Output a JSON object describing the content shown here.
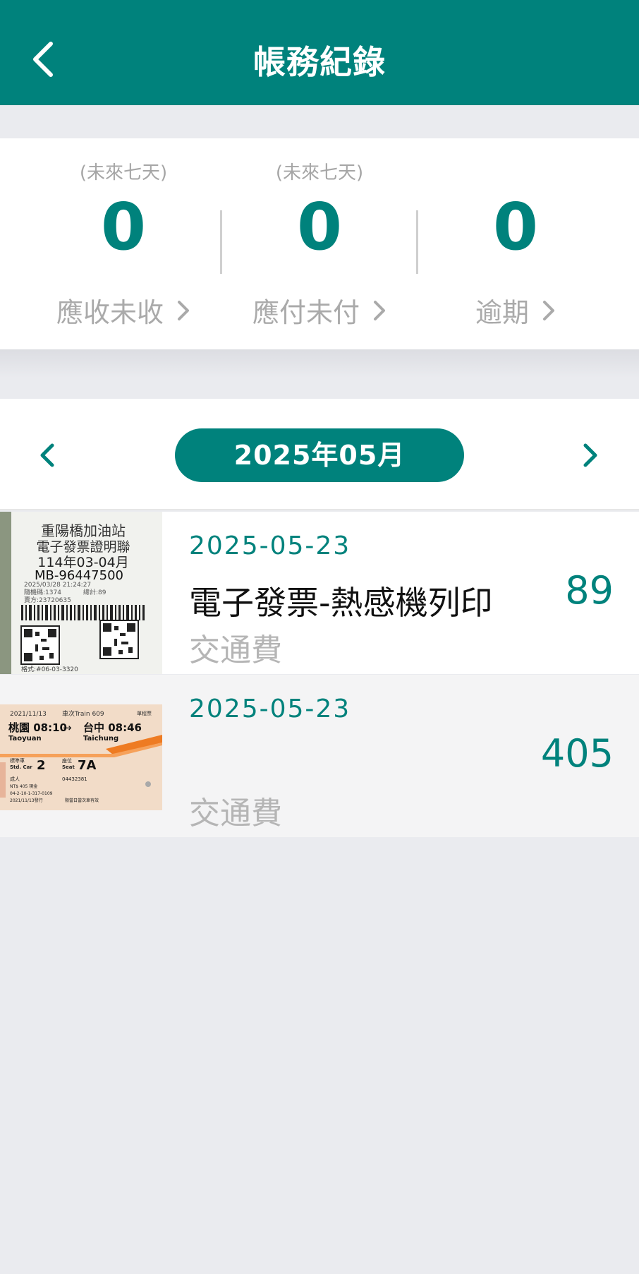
{
  "header": {
    "title": "帳務紀錄"
  },
  "summary": {
    "receivable": {
      "note": "(未來七天)",
      "count": "0",
      "label": "應收未收"
    },
    "payable": {
      "note": "(未來七天)",
      "count": "0",
      "label": "應付未付"
    },
    "overdue": {
      "count": "0",
      "label": "逾期"
    }
  },
  "month_nav": {
    "current": "2025年05月"
  },
  "records": [
    {
      "date": "2025-05-23",
      "description": "電子發票-熱感機列印",
      "category": "交通費",
      "amount": "89",
      "thumbnail": {
        "kind": "receipt",
        "lines": [
          "重陽橋加油站",
          "電子發票證明聯",
          "114年03-04月",
          "MB-96447500",
          "2025/03/28 21:24:27",
          "隨機碼:1374",
          "總計:89",
          "賣方:23720635",
          "格式:#06-03-3320"
        ]
      }
    },
    {
      "date": "2025-05-23",
      "description": "",
      "category": "交通費",
      "amount": "405",
      "thumbnail": {
        "kind": "train_ticket",
        "lines": [
          "2021/11/13",
          "車次Train 609",
          "單程票",
          "桃園 08:10",
          "Taoyuan",
          "台中 08:46",
          "Taichung",
          "標準車",
          "Std. Car",
          "2",
          "座位",
          "Seat",
          "7A",
          "成人",
          "NT$ 405 現金",
          "04432381",
          "04-2-10-1-317-0109",
          "2021/11/13發行",
          "限當日當次車有效"
        ]
      }
    }
  ],
  "colors": {
    "primary": "#00827C",
    "background": "#EAEBEF",
    "muted_text": "#AAAAAA"
  }
}
